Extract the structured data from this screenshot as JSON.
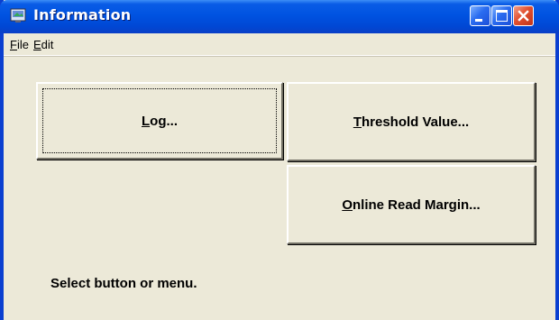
{
  "window": {
    "title": "Information"
  },
  "menu": {
    "file": {
      "mnemonic": "F",
      "rest": "ile"
    },
    "edit": {
      "mnemonic": "E",
      "rest": "dit"
    }
  },
  "buttons": {
    "log": {
      "mnemonic": "L",
      "rest": "og..."
    },
    "threshold": {
      "mnemonic": "T",
      "rest": "hreshold Value..."
    },
    "online_read_margin": {
      "mnemonic": "O",
      "rest": "nline Read Margin..."
    }
  },
  "status_text": "Select button or menu.",
  "colors": {
    "titlebar": "#0053e1",
    "close_button": "#e2502f",
    "face": "#ece9d8"
  }
}
